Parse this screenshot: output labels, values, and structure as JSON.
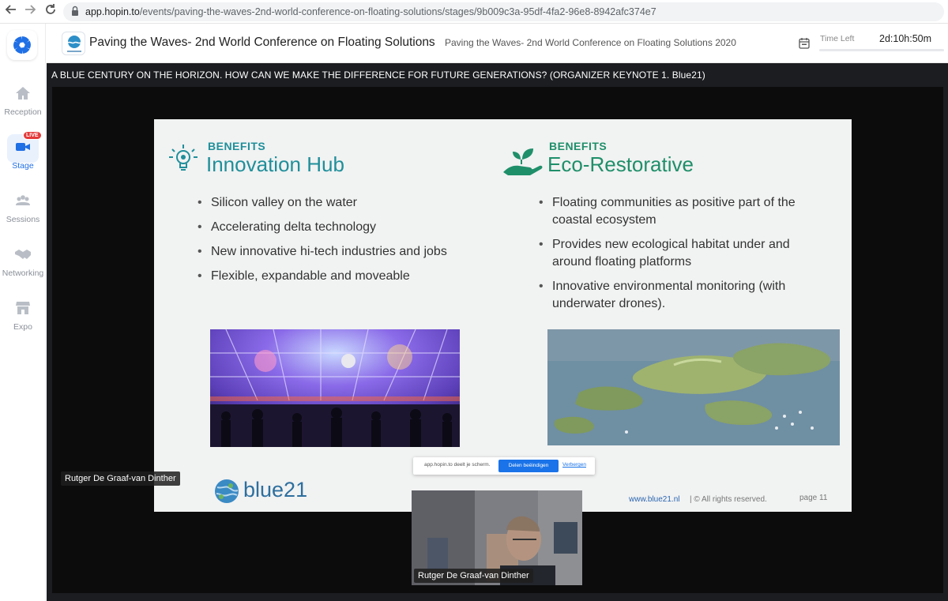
{
  "browser": {
    "url_host": "app.hopin.to",
    "url_path": "/events/paving-the-waves-2nd-world-conference-on-floating-solutions/stages/9b009c3a-95df-4fa2-96e8-8942afc374e7"
  },
  "sidebar": {
    "items": [
      {
        "label": "Reception",
        "icon": "home-icon"
      },
      {
        "label": "Stage",
        "icon": "video-camera-icon",
        "badge": "LIVE",
        "active": true
      },
      {
        "label": "Sessions",
        "icon": "people-icon"
      },
      {
        "label": "Networking",
        "icon": "handshake-icon"
      },
      {
        "label": "Expo",
        "icon": "storefront-icon"
      }
    ]
  },
  "header": {
    "event_title": "Paving the Waves- 2nd World Conference on Floating Solutions",
    "event_subtitle": "Paving the Waves- 2nd World Conference on Floating Solutions 2020",
    "time_left_label": "Time Left",
    "time_left_value": "2d:10h:50m"
  },
  "stage": {
    "session_title": "A BLUE CENTURY ON THE HORIZON. HOW CAN WE MAKE THE DIFFERENCE FOR FUTURE GENERATIONS? (ORGANIZER KEYNOTE 1. Blue21)",
    "presenter_name_slide": "Rutger De Graaf-van Dinther",
    "presenter_name_cam": "Rutger De Graaf-van Dinther"
  },
  "slide": {
    "left": {
      "kicker": "BENEFITS",
      "heading": "Innovation Hub",
      "bullets": [
        "Silicon valley on the water",
        "Accelerating delta technology",
        "New innovative hi-tech industries and jobs",
        "Flexible, expandable and moveable"
      ]
    },
    "right": {
      "kicker": "BENEFITS",
      "heading": "Eco-Restorative",
      "bullets": [
        "Floating communities as positive part of the coastal ecosystem",
        "Provides new ecological habitat under and around floating platforms",
        "Innovative environmental monitoring (with underwater drones)."
      ]
    },
    "cookie": {
      "text": "app.hopin.to deelt je scherm.",
      "stop_button": "Delen beëindigen",
      "hide_link": "Verbergen"
    },
    "logo_text": "blue21",
    "footer_url": "www.blue21.nl",
    "footer_rights": "| © All rights reserved.",
    "footer_page": "page 11"
  }
}
